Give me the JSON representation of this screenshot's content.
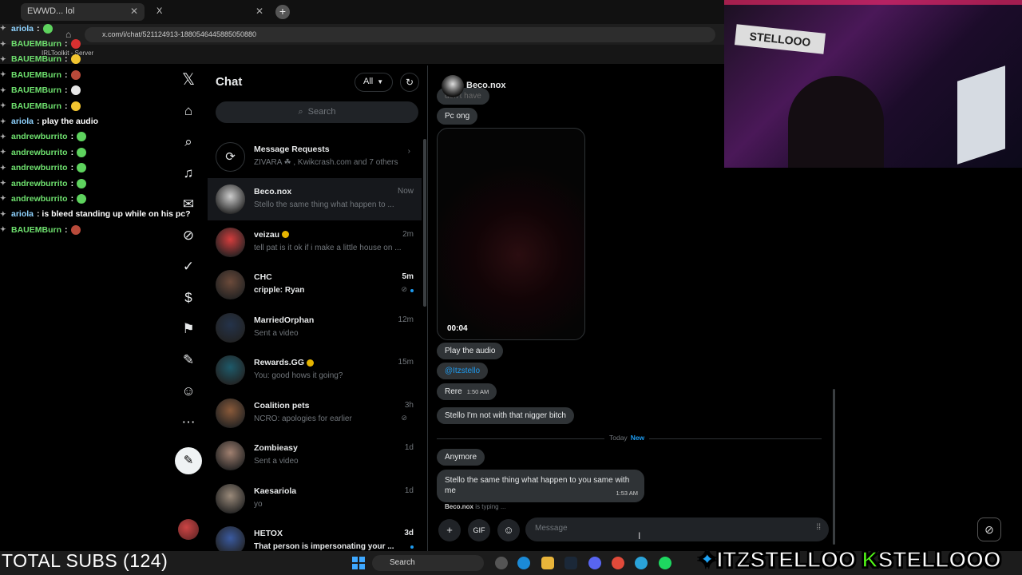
{
  "browser": {
    "tabs": [
      {
        "label": "EWWD... lol",
        "close": "✕"
      },
      {
        "label": "X",
        "close": "✕"
      }
    ],
    "new_tab": "+",
    "url": "x.com/i/chat/521124913-1880546445885050880",
    "bookmark": "IRLToolkit - Server"
  },
  "stream_chat": [
    {
      "user": "ariola",
      "text": ":",
      "color": "blue",
      "emote": "#5ed35e"
    },
    {
      "user": "BAUEMBurn",
      "text": ":",
      "color": "green",
      "emote": "#d73030"
    },
    {
      "user": "BAUEMBurn",
      "text": ":",
      "color": "green",
      "emote": "#f2c530"
    },
    {
      "user": "BAUEMBurn",
      "text": ":",
      "color": "green",
      "emote": "#b84a3a"
    },
    {
      "user": "BAUEMBurn",
      "text": ":",
      "color": "green",
      "emote": "#e6e6e6"
    },
    {
      "user": "BAUEMBurn",
      "text": ":",
      "color": "green",
      "emote": "#f2c530"
    },
    {
      "user": "ariola",
      "text": ": play the audio",
      "color": "blue",
      "emote": ""
    },
    {
      "user": "andrewburrito",
      "text": ":",
      "color": "green",
      "emote": "#5ed35e"
    },
    {
      "user": "andrewburrito",
      "text": ":",
      "color": "green",
      "emote": "#5ed35e"
    },
    {
      "user": "andrewburrito",
      "text": ":",
      "color": "green",
      "emote": "#5ed35e"
    },
    {
      "user": "andrewburrito",
      "text": ":",
      "color": "green",
      "emote": "#5ed35e"
    },
    {
      "user": "andrewburrito",
      "text": ":",
      "color": "green",
      "emote": "#5ed35e"
    },
    {
      "user": "ariola",
      "text": ": is bleed standing up while on his pc?",
      "color": "blue",
      "emote": ""
    },
    {
      "user": "BAUEMBurn",
      "text": ":",
      "color": "green",
      "emote": "#b84a3a"
    }
  ],
  "nav_icons": [
    "x-logo-icon",
    "home-icon",
    "search-icon",
    "bell-icon",
    "grok-icon",
    "communities-icon",
    "verified-icon",
    "money-icon",
    "bookmark-icon",
    "edit-list-icon",
    "profile-icon",
    "more-icon"
  ],
  "chat": {
    "title": "Chat",
    "filter": "All",
    "search_placeholder": "Search",
    "requests": {
      "title": "Message Requests",
      "preview": "ZIVARA ☘ , Kwikcrash.com and 7 others"
    },
    "conversations": [
      {
        "name": "Beco.nox",
        "time": "Now",
        "preview": "Stello the same thing what happen to ...",
        "verified": false,
        "unread": false,
        "muted": false,
        "avatar": "#ccc"
      },
      {
        "name": "veizau",
        "time": "2m",
        "preview": "tell pat is it ok if i make a little house on ...",
        "verified": true,
        "unread": false,
        "muted": false,
        "avatar": "#d43d3d"
      },
      {
        "name": "CHC",
        "time": "5m",
        "preview": "cripple: Ryan",
        "verified": false,
        "unread": true,
        "muted": true,
        "avatar": "#6b4a3a"
      },
      {
        "name": "MarriedOrphan",
        "time": "12m",
        "preview": "Sent a video",
        "verified": false,
        "unread": false,
        "muted": false,
        "avatar": "#24334a"
      },
      {
        "name": "Rewards.GG",
        "time": "15m",
        "preview": "You: good hows it going?",
        "verified": true,
        "unread": false,
        "muted": false,
        "avatar": "#1e5a6a"
      },
      {
        "name": "Coalition pets",
        "time": "3h",
        "preview": "NCRO: apologies for earlier",
        "verified": false,
        "unread": false,
        "muted": true,
        "avatar": "#8a5a3a"
      },
      {
        "name": "Zombieasy",
        "time": "1d",
        "preview": "Sent a video",
        "verified": false,
        "unread": false,
        "muted": false,
        "avatar": "#a08070"
      },
      {
        "name": "Kaesariola",
        "time": "1d",
        "preview": "yo",
        "verified": false,
        "unread": false,
        "muted": false,
        "avatar": "#9a8a7a"
      },
      {
        "name": "HETOX",
        "time": "3d",
        "preview": "That person is impersonating your ...",
        "verified": false,
        "unread": true,
        "muted": false,
        "avatar": "#3a5aa0"
      }
    ]
  },
  "thread": {
    "name": "Beco.nox",
    "partial_top": "don't have",
    "messages": [
      {
        "text": "Pc ong",
        "time": ""
      },
      {
        "text": "Play the audio",
        "time": ""
      },
      {
        "text": "@Itzstello",
        "time": ""
      },
      {
        "text": "Rere",
        "time": "1:50 AM"
      },
      {
        "text": "Stello I'm not with that nigger bitch",
        "time": ""
      },
      {
        "text": "Anymore",
        "time": ""
      },
      {
        "text": "Stello the same thing what happen to you same with me",
        "time": "1:53 AM"
      }
    ],
    "video_duration": "00:04",
    "day_label": "Today",
    "new_label": "New",
    "typing_user": "Beco.nox",
    "typing_text": "is typing ...",
    "composer_placeholder": "Message"
  },
  "webcam": {
    "sign": "STELLOOO"
  },
  "overlay": {
    "subs": "TOTAL SUBS (124)",
    "twitter": "ITZSTELLOO",
    "kick": "STELLOOO",
    "kick_letter": "K"
  },
  "taskbar": {
    "search": "Search"
  }
}
